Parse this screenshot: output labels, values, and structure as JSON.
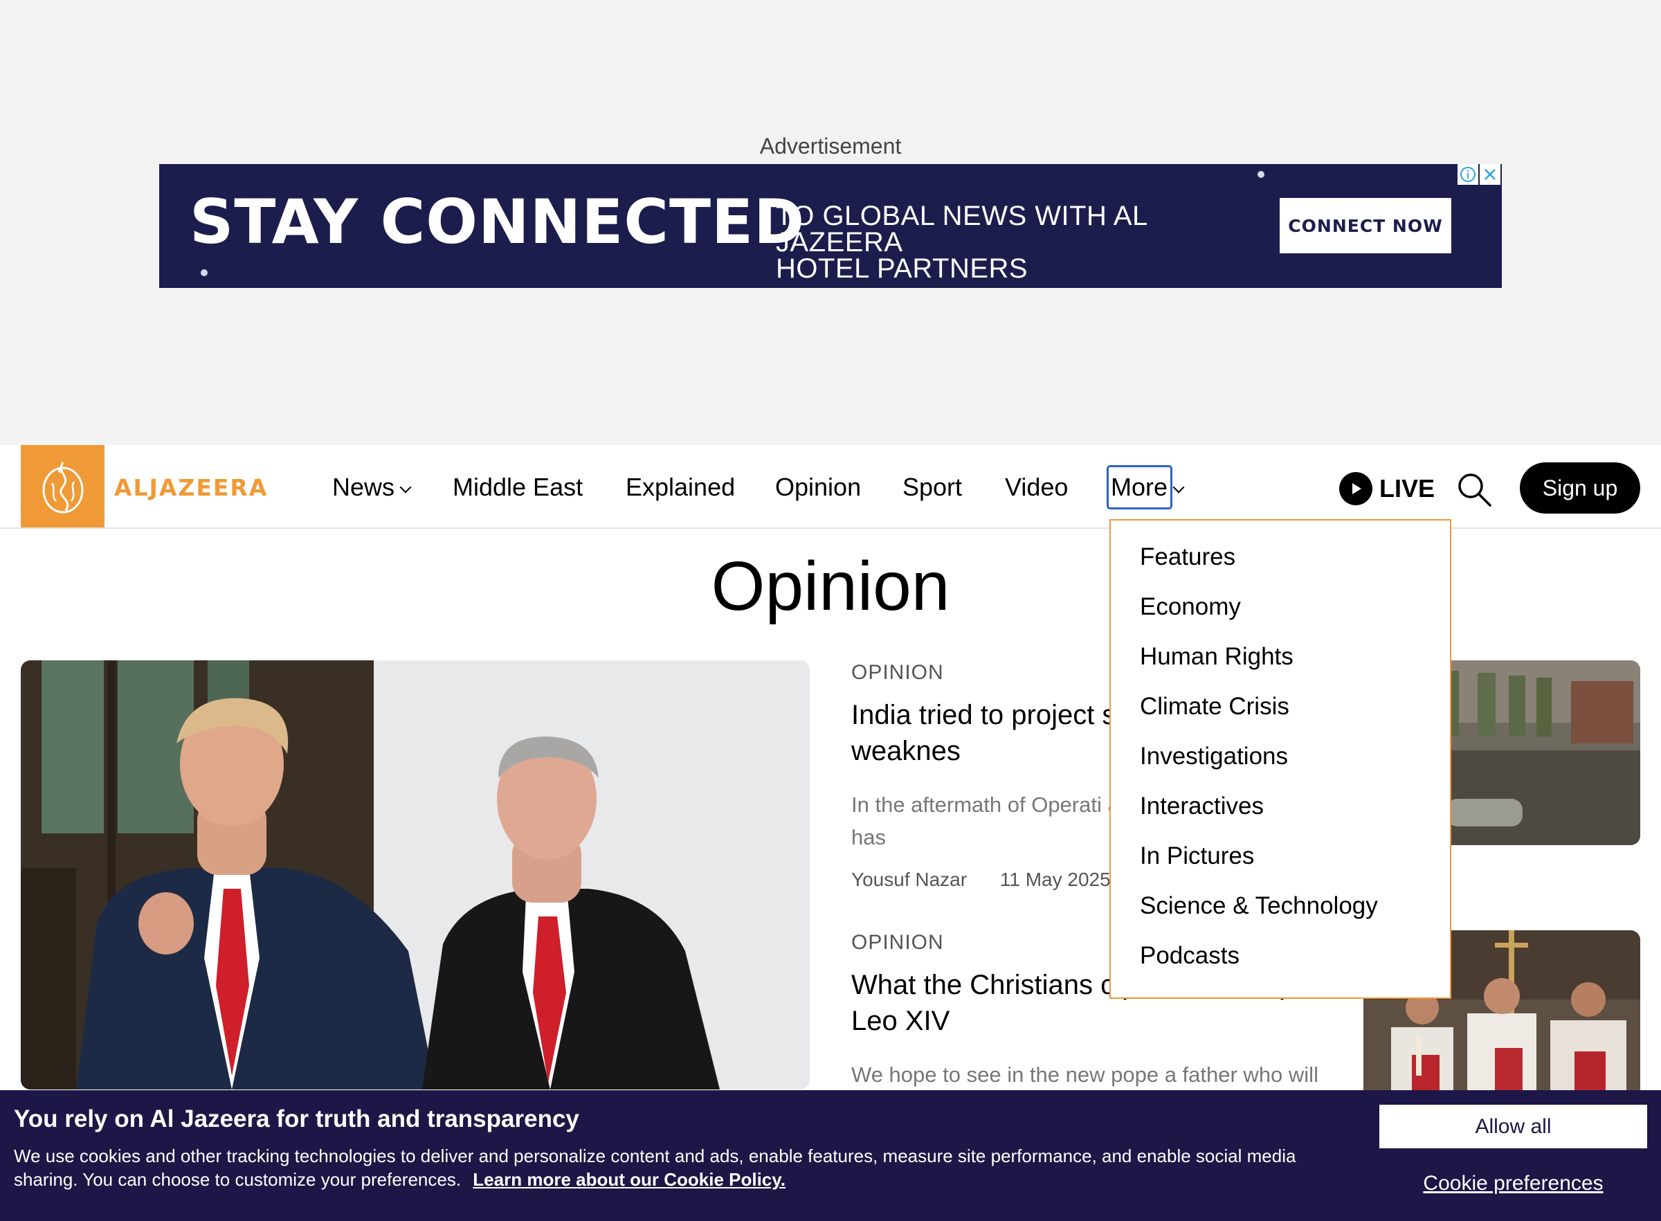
{
  "ad": {
    "label": "Advertisement",
    "headline": "STAY CONNECTED",
    "subtext_line1": "TO GLOBAL NEWS WITH AL JAZEERA",
    "subtext_line2": "HOTEL PARTNERS",
    "cta": "CONNECT NOW",
    "info_icon": "info-icon",
    "close_icon": "close-icon",
    "background_color": "#1c1d4d"
  },
  "nav": {
    "logo_text": "ALJAZEERA",
    "brand_color": "#ef9a36",
    "items": [
      {
        "label": "News",
        "has_dropdown": true
      },
      {
        "label": "Middle East",
        "has_dropdown": false
      },
      {
        "label": "Explained",
        "has_dropdown": false
      },
      {
        "label": "Opinion",
        "has_dropdown": false
      },
      {
        "label": "Sport",
        "has_dropdown": false
      },
      {
        "label": "Video",
        "has_dropdown": false
      },
      {
        "label": "More",
        "has_dropdown": true,
        "focused": true
      }
    ],
    "live_label": "LIVE",
    "signup_label": "Sign up"
  },
  "more_menu": {
    "items": [
      "Features",
      "Economy",
      "Human Rights",
      "Climate Crisis",
      "Investigations",
      "Interactives",
      "In Pictures",
      "Science & Technology",
      "Podcasts"
    ]
  },
  "page": {
    "title": "Opinion"
  },
  "articles": [
    {
      "label": "OPINION",
      "headline": "India tried to project s up showing weaknes",
      "summary": "In the aftermath of Operati as a regional hegemon has",
      "author": "Yousuf Nazar",
      "date": "11 May 2025"
    },
    {
      "label": "OPINION",
      "headline": "What the Christians c pect from Pope Leo XIV",
      "summary": "We hope to see in the new pope a father who will"
    }
  ],
  "cookie": {
    "title": "You rely on Al Jazeera for truth and transparency",
    "text": "We use cookies and other tracking technologies to deliver and personalize content and ads, enable features, measure site performance, and enable social media sharing. You can choose to customize your preferences.",
    "link": "Learn more about our Cookie Policy.",
    "allow_all": "Allow all",
    "preferences": "Cookie preferences",
    "background_color": "#1c1746"
  }
}
